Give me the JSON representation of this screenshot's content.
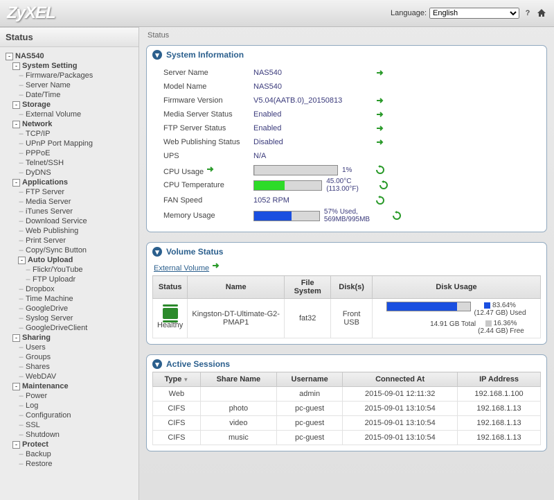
{
  "top": {
    "logo": "ZyXEL",
    "language_label": "Language:",
    "language_options": [
      "English"
    ],
    "language_selected": "English"
  },
  "sidebar_title": "Status",
  "tree": {
    "root": "NAS540",
    "groups": [
      {
        "label": "System Setting",
        "items": [
          "Firmware/Packages",
          "Server Name",
          "Date/Time"
        ]
      },
      {
        "label": "Storage",
        "items": [
          "External Volume"
        ]
      },
      {
        "label": "Network",
        "items": [
          "TCP/IP",
          "UPnP Port Mapping",
          "PPPoE",
          "Telnet/SSH",
          "DyDNS"
        ]
      },
      {
        "label": "Applications",
        "items": [
          "FTP Server",
          "Media Server",
          "iTunes Server",
          "Download Service",
          "Web Publishing",
          "Print Server",
          "Copy/Sync Button",
          {
            "label": "Auto Upload",
            "items": [
              "Flickr/YouTube",
              "FTP Uploadr"
            ]
          },
          "Dropbox",
          "Time Machine",
          "GoogleDrive",
          "Syslog Server",
          "GoogleDriveClient"
        ]
      },
      {
        "label": "Sharing",
        "items": [
          "Users",
          "Groups",
          "Shares",
          "WebDAV"
        ]
      },
      {
        "label": "Maintenance",
        "items": [
          "Power",
          "Log",
          "Configuration",
          "SSL",
          "Shutdown"
        ]
      },
      {
        "label": "Protect",
        "items": [
          "Backup",
          "Restore"
        ]
      }
    ]
  },
  "crumb": "Status",
  "sysinfo": {
    "title": "System Information",
    "server_name_k": "Server Name",
    "server_name_v": "NAS540",
    "model_name_k": "Model Name",
    "model_name_v": "NAS540",
    "firmware_k": "Firmware Version",
    "firmware_v": "V5.04(AATB.0)_20150813",
    "media_k": "Media Server Status",
    "media_v": "Enabled",
    "ftp_k": "FTP Server Status",
    "ftp_v": "Enabled",
    "web_k": "Web Publishing Status",
    "web_v": "Disabled",
    "ups_k": "UPS",
    "ups_v": "N/A",
    "cpuu_k": "CPU Usage",
    "cpuu_v": "1%",
    "cput_k": "CPU Temperature",
    "cput_v": "45.00°C (113.00°F)",
    "fan_k": "FAN Speed",
    "fan_v": "1052 RPM",
    "mem_k": "Memory Usage",
    "mem_v": "57% Used, 569MB/995MB"
  },
  "volume": {
    "title": "Volume Status",
    "link": "External Volume",
    "headers": {
      "status": "Status",
      "name": "Name",
      "fs": "File System",
      "disks": "Disk(s)",
      "usage": "Disk Usage"
    },
    "rows": [
      {
        "status": "Healthy",
        "name": "Kingston-DT-Ultimate-G2-PMAP1",
        "fs": "fat32",
        "disks": "Front USB",
        "used_pct": "83.64%",
        "used_gb": "(12.47 GB) Used",
        "free_pct": "16.36%",
        "free_gb": "(2.44 GB) Free",
        "total": "14.91 GB Total",
        "pct_fill": 83.64
      }
    ]
  },
  "sessions": {
    "title": "Active Sessions",
    "headers": {
      "type": "Type",
      "share": "Share Name",
      "user": "Username",
      "conn": "Connected At",
      "ip": "IP Address"
    },
    "rows": [
      {
        "type": "Web",
        "share": "",
        "user": "admin",
        "conn": "2015-09-01 12:11:32",
        "ip": "192.168.1.100"
      },
      {
        "type": "CIFS",
        "share": "photo",
        "user": "pc-guest",
        "conn": "2015-09-01 13:10:54",
        "ip": "192.168.1.13"
      },
      {
        "type": "CIFS",
        "share": "video",
        "user": "pc-guest",
        "conn": "2015-09-01 13:10:54",
        "ip": "192.168.1.13"
      },
      {
        "type": "CIFS",
        "share": "music",
        "user": "pc-guest",
        "conn": "2015-09-01 13:10:54",
        "ip": "192.168.1.13"
      }
    ]
  }
}
